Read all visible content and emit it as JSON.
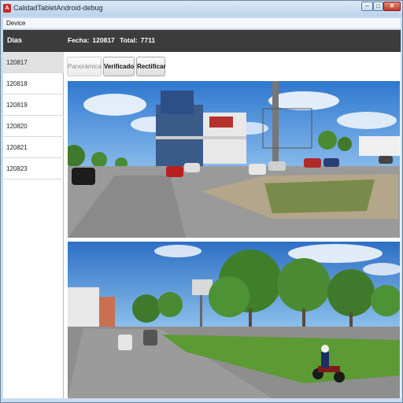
{
  "window": {
    "title": "CalidadTabletAndroid-debug",
    "controls": {
      "minimize": "–",
      "maximize": "□",
      "close": "✕"
    }
  },
  "menu": {
    "items": [
      "Device"
    ]
  },
  "sidebar": {
    "header": "Dias",
    "items": [
      {
        "label": "120817",
        "selected": true
      },
      {
        "label": "120818",
        "selected": false
      },
      {
        "label": "120819",
        "selected": false
      },
      {
        "label": "120820",
        "selected": false
      },
      {
        "label": "120821",
        "selected": false
      },
      {
        "label": "120823",
        "selected": false
      }
    ]
  },
  "header": {
    "fecha_label": "Fecha:",
    "fecha_value": "120817",
    "total_label": "Total:",
    "total_value": "7711"
  },
  "toolbar": {
    "panoramica": "Panorámica",
    "verificado": "Verificado",
    "rectificar": "Rectificar"
  },
  "photos": [
    {
      "name": "panorama-1",
      "description": "Street panorama with car dealership and parked cars"
    },
    {
      "name": "panorama-2",
      "description": "Street panorama with trees, median and motorcyclist"
    }
  ],
  "colors": {
    "header_bg": "#3c3c3c",
    "selected_row": "#e1e1e1",
    "sky": "#3a86d6"
  }
}
